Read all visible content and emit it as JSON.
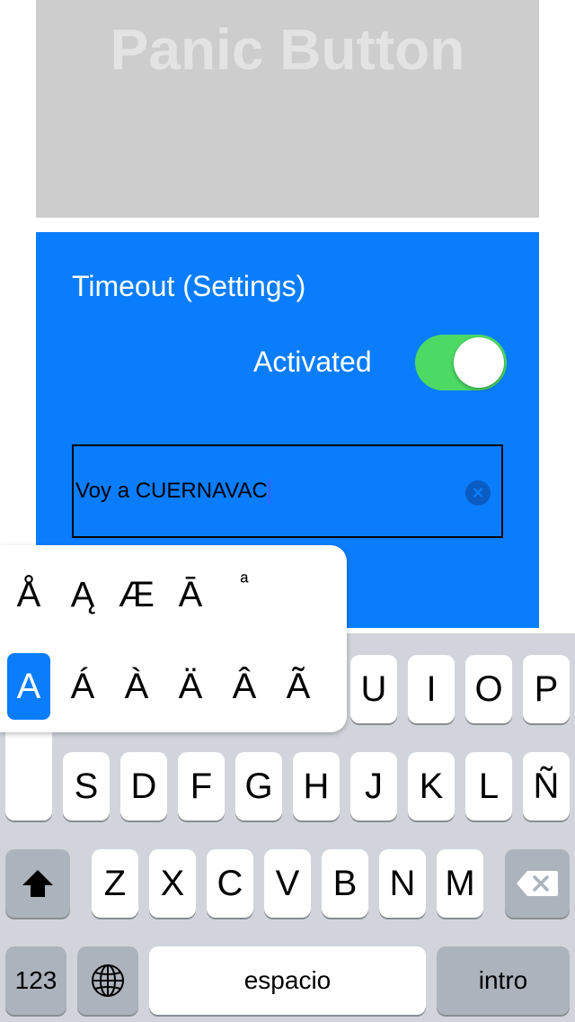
{
  "panic": {
    "label": "Panic Button"
  },
  "settings": {
    "title": "Timeout (Settings)",
    "activated_label": "Activated",
    "activated": true,
    "message_value": "Voy a CUERNAVAC",
    "clear_icon": "clear-circle-icon"
  },
  "keyboard": {
    "accent_popup": {
      "row1": [
        "Å",
        "Ą",
        "Æ",
        "Ā",
        "ª"
      ],
      "row2": [
        "A",
        "Á",
        "À",
        "Ä",
        "Â",
        "Ã"
      ],
      "selected": "A"
    },
    "row1_visible": [
      "U",
      "I",
      "O",
      "P"
    ],
    "row2": [
      "S",
      "D",
      "F",
      "G",
      "H",
      "J",
      "K",
      "L",
      "Ñ"
    ],
    "row3": [
      "Z",
      "X",
      "C",
      "V",
      "B",
      "N",
      "M"
    ],
    "shift_icon": "shift-arrow-icon",
    "delete_icon": "backspace-icon",
    "numbers_label": "123",
    "globe_icon": "globe-icon",
    "space_label": "espacio",
    "return_label": "intro"
  },
  "colors": {
    "panel_blue": "#0a7dfd",
    "toggle_green": "#4cd964",
    "panic_gray": "#cdcdcd"
  }
}
